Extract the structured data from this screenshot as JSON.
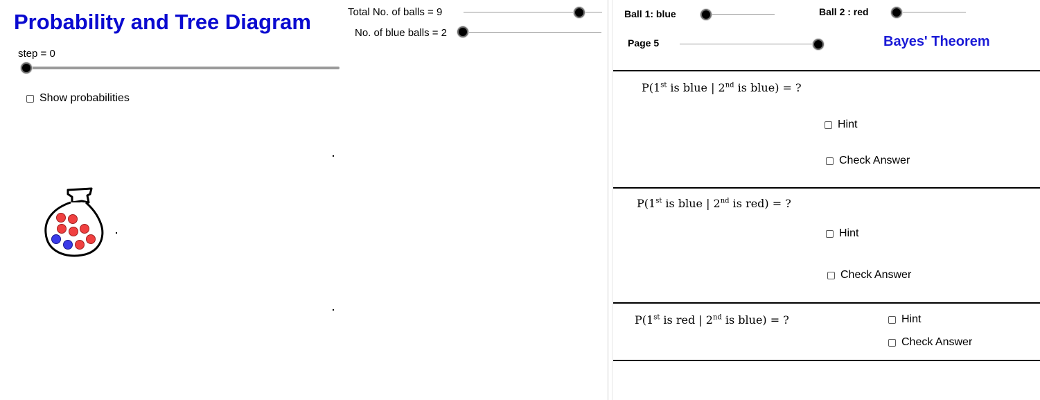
{
  "left_panel": {
    "title": "Probability and Tree Diagram",
    "step_label": "step = 0",
    "show_probabilities_label": "Show probabilities"
  },
  "middle_panel": {
    "total_balls_label": "Total No. of balls = 9",
    "blue_balls_label": "No. of blue balls = 2"
  },
  "bag": {
    "red_balls": 7,
    "blue_balls": 2,
    "red_color": "#f04040",
    "blue_color": "#3a3ae8"
  },
  "right_panel": {
    "ball1_label": "Ball 1: blue",
    "ball2_label": "Ball 2 : red",
    "page_label": "Page 5",
    "bayes_title": "Bayes' Theorem",
    "questions": [
      {
        "prefix": "P(1",
        "sup1": "st",
        "mid": " is blue | 2",
        "sup2": "nd",
        "suffix": " is blue) = ?",
        "hint_label": "Hint",
        "check_label": "Check Answer"
      },
      {
        "prefix": "P(1",
        "sup1": "st",
        "mid": " is blue | 2",
        "sup2": "nd",
        "suffix": " is red) = ?",
        "hint_label": "Hint",
        "check_label": "Check Answer"
      },
      {
        "prefix": "P(1",
        "sup1": "st",
        "mid": " is red | 2",
        "sup2": "nd",
        "suffix": " is blue) = ?",
        "hint_label": "Hint",
        "check_label": "Check Answer"
      }
    ]
  },
  "colors": {
    "title": "#0a0ad0",
    "bayes": "#1a1ad6"
  }
}
